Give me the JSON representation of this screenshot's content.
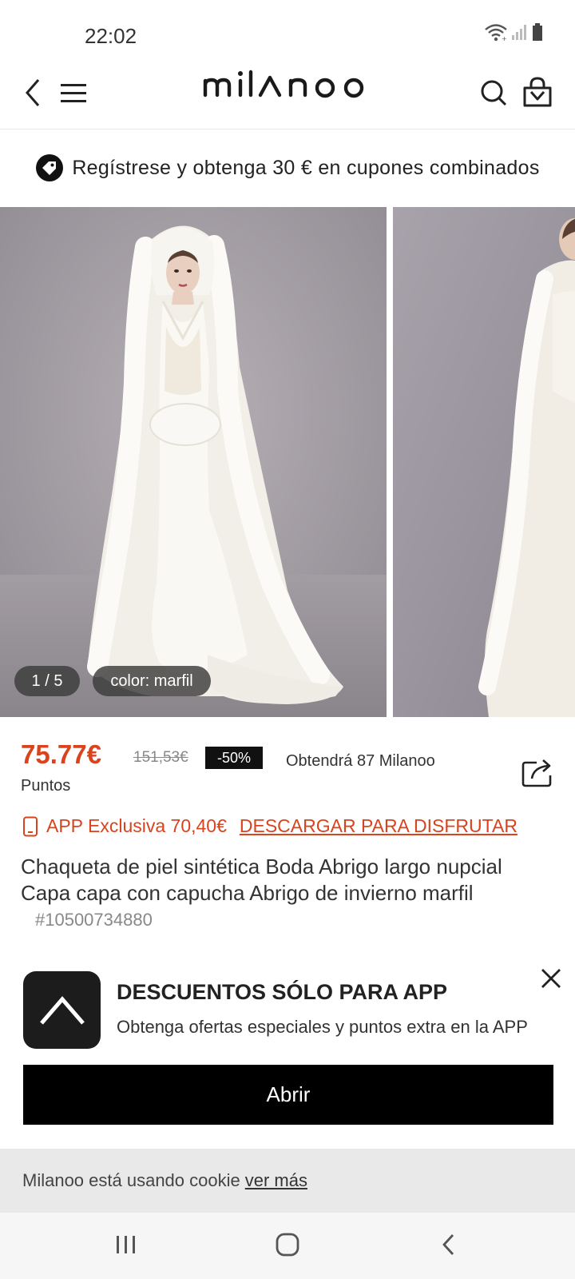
{
  "status_bar": {
    "time": "22:02"
  },
  "header": {
    "logo_text": "milanoo"
  },
  "promo": {
    "text": "Regístrese y obtenga 30 € en cupones combinados"
  },
  "gallery": {
    "counter": "1 / 5",
    "color_label": "color: marfil"
  },
  "pricing": {
    "price": "75.77€",
    "original_price": "151,53€",
    "discount": "-50%",
    "points_text": "Obtendrá 87 Milanoo",
    "points_unit": "Puntos"
  },
  "app_exclusive": {
    "label": "APP Exclusiva 70,40€",
    "link": "DESCARGAR PARA DISFRUTAR"
  },
  "product": {
    "title": "Chaqueta de piel sintética Boda Abrigo largo nupcial Capa capa con capucha Abrigo de invierno marfil",
    "sku": "#10500734880"
  },
  "app_banner": {
    "heading": "DESCUENTOS SÓLO PARA APP",
    "subtitle": "Obtenga ofertas especiales y puntos extra en la APP",
    "open_button": "Abrir"
  },
  "cookie": {
    "text": "Milanoo está usando cookie",
    "link": "ver más"
  },
  "colors": {
    "accent": "#d9431e",
    "black": "#000000"
  }
}
